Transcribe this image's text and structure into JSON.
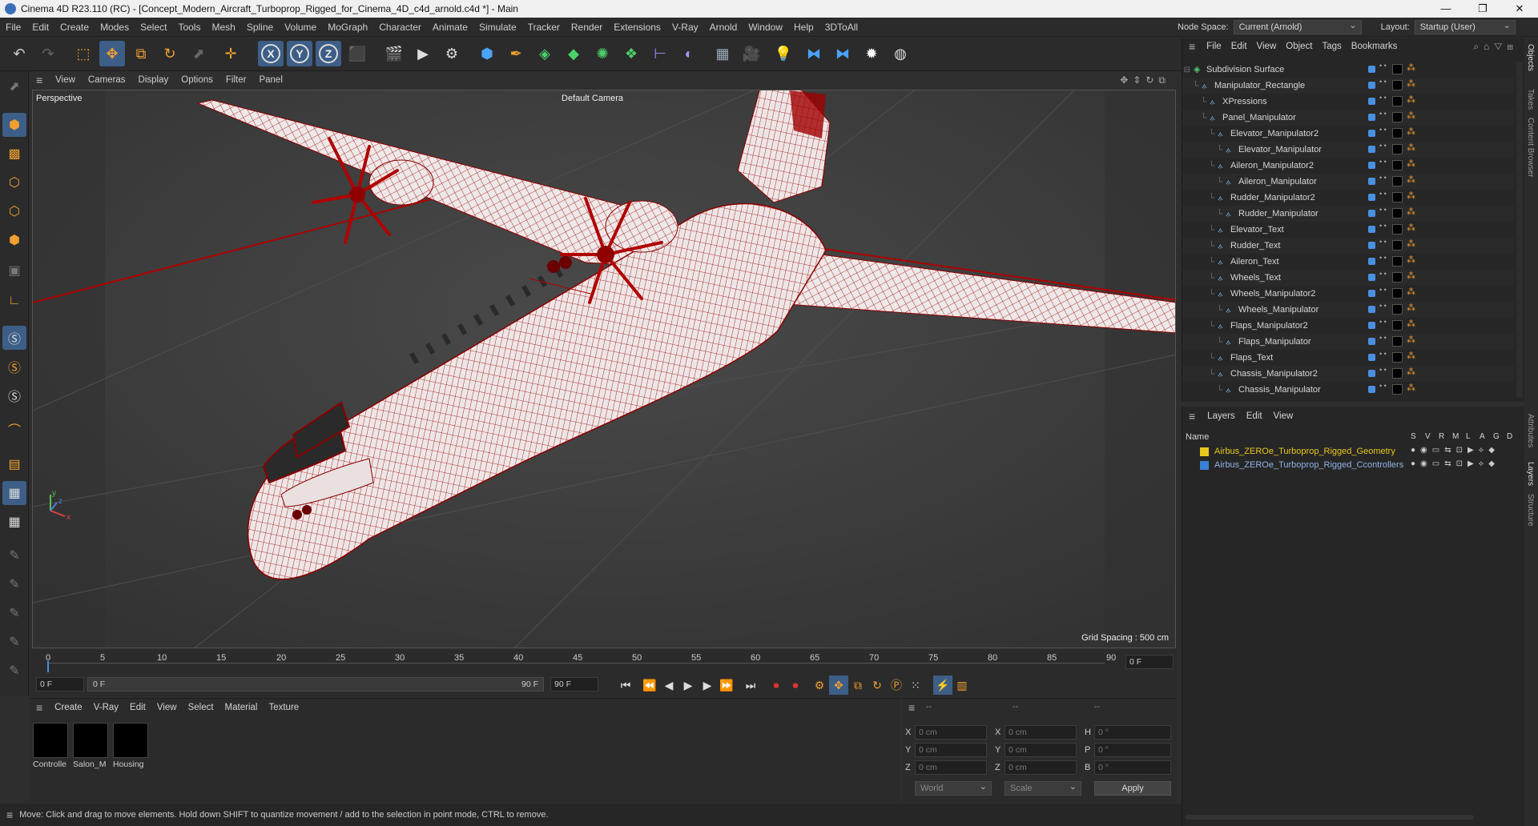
{
  "window": {
    "title": "Cinema 4D R23.110 (RC) - [Concept_Modern_Aircraft_Turboprop_Rigged_for_Cinema_4D_c4d_arnold.c4d *] - Main",
    "minimize": "—",
    "maximize": "❐",
    "close": "✕"
  },
  "menubar": {
    "items": [
      "File",
      "Edit",
      "Create",
      "Modes",
      "Select",
      "Tools",
      "Mesh",
      "Spline",
      "Volume",
      "MoGraph",
      "Character",
      "Animate",
      "Simulate",
      "Tracker",
      "Render",
      "Extensions",
      "V-Ray",
      "Arnold",
      "Window",
      "Help",
      "3DToAll"
    ],
    "node_space_label": "Node Space:",
    "node_space_value": "Current (Arnold)",
    "layout_label": "Layout:",
    "layout_value": "Startup (User)"
  },
  "toolbar": {
    "axis_x": "X",
    "axis_y": "Y",
    "axis_z": "Z"
  },
  "viewport": {
    "menu": [
      "View",
      "Cameras",
      "Display",
      "Options",
      "Filter",
      "Panel"
    ],
    "label": "Perspective",
    "camera": "Default Camera",
    "grid_spacing": "Grid Spacing : 500 cm",
    "axis_y": "y",
    "axis_z": "z",
    "axis_x": "x",
    "accent_color": "#b00000",
    "surface_color": "#e6dede"
  },
  "timeline": {
    "ticks": [
      "0",
      "5",
      "10",
      "15",
      "20",
      "25",
      "30",
      "35",
      "40",
      "45",
      "50",
      "55",
      "60",
      "65",
      "70",
      "75",
      "80",
      "85",
      "90"
    ],
    "current_frame": "0 F",
    "start_frame": "0 F",
    "range_start": "0 F",
    "range_end": "90 F",
    "end_frame": "90 F"
  },
  "materials": {
    "menu": [
      "Create",
      "V-Ray",
      "Edit",
      "View",
      "Select",
      "Material",
      "Texture"
    ],
    "items": [
      "Controlle",
      "Salon_M",
      "Housing"
    ]
  },
  "coords": {
    "headers": [
      "--",
      "--",
      "--"
    ],
    "rows": [
      {
        "a": "X",
        "av": "0 cm",
        "b": "X",
        "bv": "0 cm",
        "c": "H",
        "cv": "0 °"
      },
      {
        "a": "Y",
        "av": "0 cm",
        "b": "Y",
        "bv": "0 cm",
        "c": "P",
        "cv": "0 °"
      },
      {
        "a": "Z",
        "av": "0 cm",
        "b": "Z",
        "bv": "0 cm",
        "c": "B",
        "cv": "0 °"
      }
    ],
    "world": "World",
    "scale": "Scale",
    "apply": "Apply"
  },
  "status": "Move: Click and drag to move elements. Hold down SHIFT to quantize movement / add to the selection in point mode, CTRL to remove.",
  "objects": {
    "menu": [
      "File",
      "Edit",
      "View",
      "Object",
      "Tags",
      "Bookmarks"
    ],
    "rows": [
      {
        "name": "Subdivision Surface",
        "indent": 0,
        "icon": "subdivision-icon"
      },
      {
        "name": "Manipulator_Rectangle",
        "indent": 1,
        "icon": "null-icon"
      },
      {
        "name": "XPressions",
        "indent": 2,
        "icon": "null-icon"
      },
      {
        "name": "Panel_Manipulator",
        "indent": 2,
        "icon": "null-icon"
      },
      {
        "name": "Elevator_Manipulator2",
        "indent": 3,
        "icon": "null-icon"
      },
      {
        "name": "Elevator_Manipulator",
        "indent": 4,
        "icon": "null-icon"
      },
      {
        "name": "Aileron_Manipulator2",
        "indent": 3,
        "icon": "null-icon"
      },
      {
        "name": "Aileron_Manipulator",
        "indent": 4,
        "icon": "null-icon"
      },
      {
        "name": "Rudder_Manipulator2",
        "indent": 3,
        "icon": "null-icon"
      },
      {
        "name": "Rudder_Manipulator",
        "indent": 4,
        "icon": "null-icon"
      },
      {
        "name": "Elevator_Text",
        "indent": 3,
        "icon": "null-icon"
      },
      {
        "name": "Rudder_Text",
        "indent": 3,
        "icon": "null-icon"
      },
      {
        "name": "Aileron_Text",
        "indent": 3,
        "icon": "null-icon"
      },
      {
        "name": "Wheels_Text",
        "indent": 3,
        "icon": "null-icon"
      },
      {
        "name": "Wheels_Manipulator2",
        "indent": 3,
        "icon": "null-icon"
      },
      {
        "name": "Wheels_Manipulator",
        "indent": 4,
        "icon": "null-icon"
      },
      {
        "name": "Flaps_Manipulator2",
        "indent": 3,
        "icon": "null-icon"
      },
      {
        "name": "Flaps_Manipulator",
        "indent": 4,
        "icon": "null-icon"
      },
      {
        "name": "Flaps_Text",
        "indent": 3,
        "icon": "null-icon"
      },
      {
        "name": "Chassis_Manipulator2",
        "indent": 3,
        "icon": "null-icon"
      },
      {
        "name": "Chassis_Manipulator",
        "indent": 4,
        "icon": "null-icon"
      }
    ]
  },
  "layers": {
    "menu": [
      "Layers",
      "Edit",
      "View"
    ],
    "name_header": "Name",
    "col_headers": [
      "S",
      "V",
      "R",
      "M",
      "L",
      "A",
      "G",
      "D"
    ],
    "rows": [
      {
        "name": "Airbus_ZEROe_Turboprop_Rigged_Geometry",
        "color": "#e8c81c"
      },
      {
        "name": "Airbus_ZEROe_Turboprop_Rigged_Ccontrollers",
        "color": "#3a7fd6"
      }
    ]
  },
  "side_tabs": [
    "Objects",
    "Takes",
    "Content Browser",
    "Attributes",
    "Layers",
    "Structure"
  ]
}
